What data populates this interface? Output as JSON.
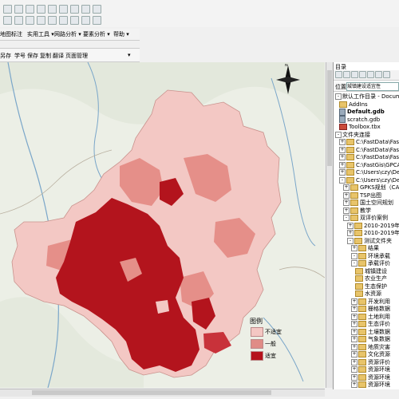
{
  "menubar": {
    "items": [
      "地图标注",
      "实用工具 ▾",
      "网路分析 ▾",
      "要素分析 ▾",
      "帮助 ▾"
    ]
  },
  "toolbar2": {
    "items": [
      "另存",
      "学号",
      "保存",
      "复制",
      "翻译",
      "页面管理"
    ]
  },
  "catalog": {
    "title": "目录",
    "location_label": "位置:",
    "location_value": "城镇建设适宜性",
    "tree": [
      {
        "label": "默认工作目录 - Documen",
        "indent": 0,
        "icon": "none",
        "expand": "-"
      },
      {
        "label": "AddIns",
        "indent": 1,
        "icon": "folder",
        "expand": ""
      },
      {
        "label": "Default.gdb",
        "indent": 1,
        "icon": "db",
        "expand": "",
        "bold": true
      },
      {
        "label": "scratch.gdb",
        "indent": 1,
        "icon": "db",
        "expand": ""
      },
      {
        "label": "Toolbox.tbx",
        "indent": 1,
        "icon": "tool",
        "expand": ""
      },
      {
        "label": "文件夹连接",
        "indent": 0,
        "icon": "none",
        "expand": "-"
      },
      {
        "label": "C:\\FastData\\FastTSP",
        "indent": 1,
        "icon": "folder",
        "expand": "+"
      },
      {
        "label": "C:\\FastData\\FastTSP",
        "indent": 1,
        "icon": "folder",
        "expand": "+"
      },
      {
        "label": "C:\\FastData\\FastTSP",
        "indent": 1,
        "icon": "folder",
        "expand": "+"
      },
      {
        "label": "C:\\FastGis\\GPCADIC",
        "indent": 1,
        "icon": "folder",
        "expand": "+"
      },
      {
        "label": "C:\\Users\\czy\\Desktop",
        "indent": 1,
        "icon": "folder",
        "expand": "+"
      },
      {
        "label": "C:\\Users\\czy\\Deskto",
        "indent": 1,
        "icon": "folder",
        "expand": "-"
      },
      {
        "label": "GPKS规划（CAD）",
        "indent": 2,
        "icon": "folder",
        "expand": "+"
      },
      {
        "label": "TSP出图",
        "indent": 2,
        "icon": "folder",
        "expand": "+"
      },
      {
        "label": "国土空间规划",
        "indent": 2,
        "icon": "folder",
        "expand": "+"
      },
      {
        "label": "教学",
        "indent": 2,
        "icon": "folder",
        "expand": "+"
      },
      {
        "label": "双评价案例",
        "indent": 2,
        "icon": "folder",
        "expand": "-"
      },
      {
        "label": "2010-2019年",
        "indent": 3,
        "icon": "folder",
        "expand": "+"
      },
      {
        "label": "2010-2019年降",
        "indent": 3,
        "icon": "folder",
        "expand": "+"
      },
      {
        "label": "测试文件夹",
        "indent": 3,
        "icon": "folder",
        "expand": "-"
      },
      {
        "label": "结果",
        "indent": 4,
        "icon": "folder",
        "expand": "+"
      },
      {
        "label": "环境承载",
        "indent": 4,
        "icon": "folder",
        "expand": "-"
      },
      {
        "label": "承载评价",
        "indent": 4,
        "icon": "folder",
        "expand": "-"
      },
      {
        "label": "城镇建设",
        "indent": 5,
        "icon": "folder",
        "expand": ""
      },
      {
        "label": "农业生产",
        "indent": 5,
        "icon": "folder",
        "expand": ""
      },
      {
        "label": "生态保护",
        "indent": 5,
        "icon": "folder",
        "expand": ""
      },
      {
        "label": "水资源",
        "indent": 5,
        "icon": "folder",
        "expand": ""
      },
      {
        "label": "开发利用",
        "indent": 4,
        "icon": "folder",
        "expand": "+"
      },
      {
        "label": "栅格数据",
        "indent": 4,
        "icon": "folder",
        "expand": "+"
      },
      {
        "label": "土地利用",
        "indent": 4,
        "icon": "folder",
        "expand": "+"
      },
      {
        "label": "生态评价",
        "indent": 4,
        "icon": "folder",
        "expand": "+"
      },
      {
        "label": "土壤数据",
        "indent": 4,
        "icon": "folder",
        "expand": "+"
      },
      {
        "label": "气象数据",
        "indent": 4,
        "icon": "folder",
        "expand": "+"
      },
      {
        "label": "地质灾害",
        "indent": 4,
        "icon": "folder",
        "expand": "+"
      },
      {
        "label": "文化资源",
        "indent": 4,
        "icon": "folder",
        "expand": "+"
      },
      {
        "label": "资源评价",
        "indent": 4,
        "icon": "folder",
        "expand": "+"
      },
      {
        "label": "资源环境",
        "indent": 4,
        "icon": "folder",
        "expand": "+"
      },
      {
        "label": "资源环境",
        "indent": 4,
        "icon": "folder",
        "expand": "+"
      },
      {
        "label": "资源环境",
        "indent": 4,
        "icon": "folder",
        "expand": "+"
      }
    ]
  },
  "legend": {
    "title": "图例",
    "items": [
      {
        "label": "不适宜",
        "color": "#f4c7c3"
      },
      {
        "label": "一般",
        "color": "#e08c86"
      },
      {
        "label": "适宜",
        "color": "#b5121b"
      }
    ]
  },
  "colors": {
    "map_bg": "#eef1e8",
    "region_light": "#f3c8c4",
    "region_mid": "#e58f89",
    "region_dark": "#b3141d",
    "river": "#7aa6c9"
  }
}
